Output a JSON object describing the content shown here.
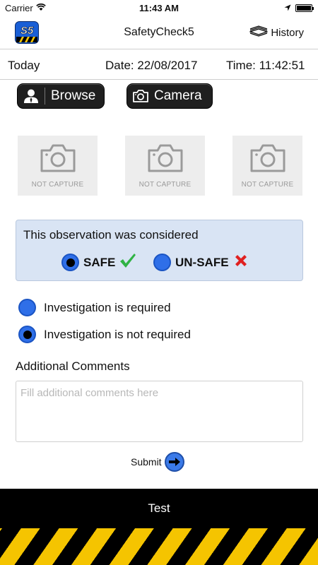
{
  "status_bar": {
    "carrier": "Carrier",
    "time": "11:43 AM",
    "battery_level": 1.0
  },
  "nav": {
    "logo_text": "S5",
    "title": "SafetyCheck5",
    "history_label": "History"
  },
  "info": {
    "today": "Today",
    "date": "Date: 22/08/2017",
    "time": "Time: 11:42:51"
  },
  "photo_buttons": {
    "browse_label": "Browse",
    "camera_label": "Camera"
  },
  "captures": [
    {
      "label": "NOT CAPTURE"
    },
    {
      "label": "NOT CAPTURE"
    },
    {
      "label": "NOT CAPTURE"
    }
  ],
  "observation": {
    "title": "This observation was considered",
    "options": [
      {
        "label": "SAFE",
        "selected": true
      },
      {
        "label": "UN-SAFE",
        "selected": false
      }
    ]
  },
  "investigation": [
    {
      "label": "Investigation is required",
      "selected": false
    },
    {
      "label": "Investigation is not required",
      "selected": true
    }
  ],
  "comments": {
    "label": "Additional Comments",
    "placeholder": "Fill additional comments here",
    "value": ""
  },
  "submit_label": "Submit",
  "footer": {
    "title": "Test"
  },
  "colors": {
    "radio_blue": "#2f6fe8",
    "observation_bg": "#d9e4f4",
    "check_green": "#2fb344",
    "cross_red": "#e02020",
    "hazard_yellow": "#f5c400"
  }
}
